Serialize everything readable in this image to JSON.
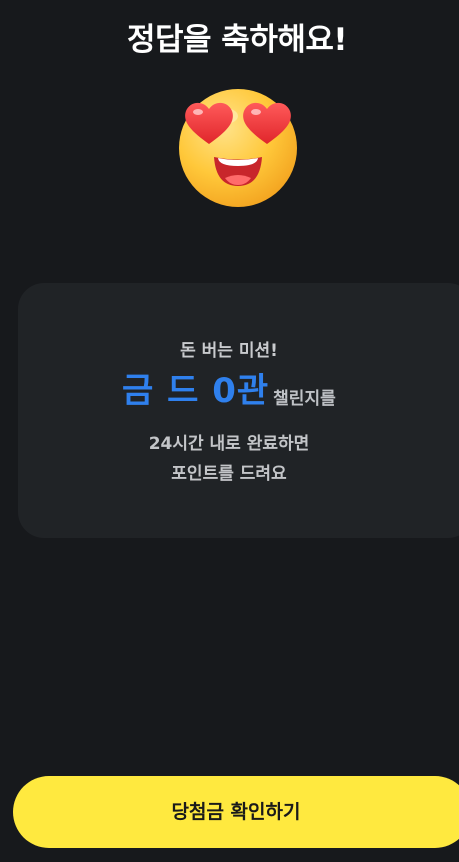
{
  "header": {
    "title": "정답을 축하해요!"
  },
  "hero": {
    "icon": "heart-eyes-emoji-icon"
  },
  "card": {
    "mission_label": "돈 버는 미션!",
    "challenge_highlight": "금 드 0관",
    "challenge_suffix": "챌린지를",
    "description_line1": "24시간 내로 완료하면",
    "description_line2": "포인트를 드려요"
  },
  "cta": {
    "label": "당첨금 확인하기"
  },
  "colors": {
    "background": "#17191c",
    "card": "#202326",
    "accent_blue": "#2f80ed",
    "button_yellow": "#ffe93f"
  }
}
